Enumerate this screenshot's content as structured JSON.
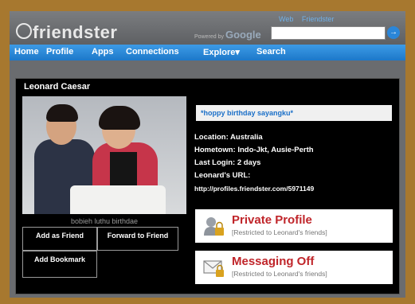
{
  "header": {
    "logo_text": "friendster",
    "search_radio_web": "Web",
    "search_radio_friendster": "Friendster",
    "google_powered": "Powered by",
    "google_label": "Google",
    "search_value": "",
    "search_go": "→"
  },
  "nav": {
    "items": [
      {
        "label": "Home"
      },
      {
        "label": "Profile"
      },
      {
        "label": "Apps"
      },
      {
        "label": "Connections"
      },
      {
        "label": "Explore▾"
      },
      {
        "label": "Search"
      }
    ]
  },
  "profile": {
    "name": "Leonard Caesar",
    "photo_caption": "bobieh luthu birthdae",
    "status": "*hoppy birthday sayangku*",
    "location": "Location: Australia",
    "hometown": "Hometown: Indo-Jkt, Ausie-Perth",
    "last_login": "Last Login: 2 days",
    "url_label": "Leonard's URL:",
    "url_value": "http://profiles.friendster.com/5971149"
  },
  "actions": {
    "add_friend": "Add as Friend",
    "forward_friend": "Forward to Friend",
    "add_bookmark": "Add Bookmark"
  },
  "private_card": {
    "title": "Private Profile",
    "subtitle": "[Restricted to Leonard's friends]",
    "icon": "lock-user-icon"
  },
  "messaging_card": {
    "title": "Messaging Off",
    "subtitle": "[Restricted to Leonard's friends]",
    "icon": "envelope-lock-icon"
  }
}
